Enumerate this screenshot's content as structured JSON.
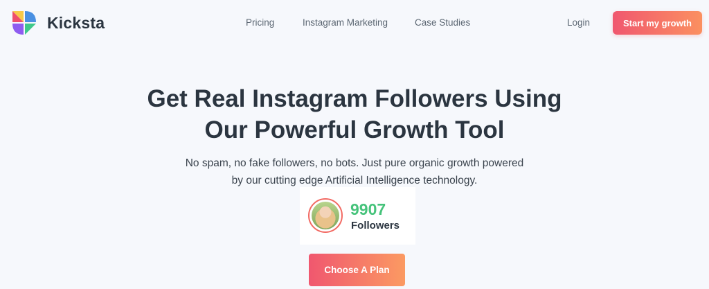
{
  "brand": {
    "name": "Kicksta",
    "logo_icon": "kicksta-pinwheel-logo"
  },
  "nav": {
    "items": [
      {
        "label": "Pricing"
      },
      {
        "label": "Instagram Marketing"
      },
      {
        "label": "Case Studies"
      }
    ],
    "login_label": "Login",
    "cta_label": "Start my growth"
  },
  "hero": {
    "headline_line1": "Get Real Instagram Followers Using",
    "headline_line2": "Our Powerful Growth Tool",
    "sub_line1": "No spam, no fake followers, no bots. Just pure organic growth powered",
    "sub_line2": "by our cutting edge Artificial Intelligence technology."
  },
  "followers_widget": {
    "count": "9907",
    "label": "Followers",
    "avatar_icon": "user-avatar",
    "count_color": "#46c37b"
  },
  "cta": {
    "label": "Choose A Plan"
  },
  "colors": {
    "accent_start": "#f0576f",
    "accent_end": "#fb9060",
    "text_dark": "#2b3540",
    "background": "#f6f8fc"
  }
}
